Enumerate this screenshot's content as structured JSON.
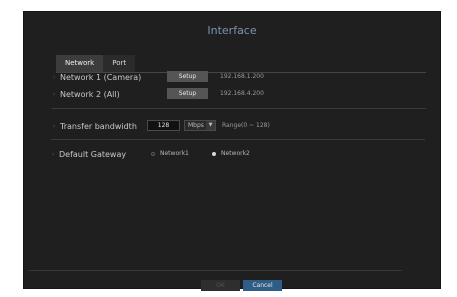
{
  "dialog": {
    "title": "Interface"
  },
  "tabs": [
    {
      "label": "Network",
      "active": true
    },
    {
      "label": "Port",
      "active": false
    }
  ],
  "networks": [
    {
      "label": "Network 1 (Camera)",
      "button": "Setup",
      "ip": "192.168.1.200"
    },
    {
      "label": "Network 2 (All)",
      "button": "Setup",
      "ip": "192.168.4.200"
    }
  ],
  "bandwidth": {
    "label": "Transfer bandwidth",
    "value": "128",
    "unit": "Mbps",
    "range": "Range(0 ~ 128)"
  },
  "gateway": {
    "label": "Default Gateway",
    "options": [
      {
        "label": "Network1",
        "selected": false
      },
      {
        "label": "Network2",
        "selected": true
      }
    ]
  },
  "footer": {
    "ok": "OK",
    "cancel": "Cancel"
  },
  "colors": {
    "title": "#7d94ab",
    "accent": "#2f5d86",
    "background": "#1f1f1f"
  }
}
